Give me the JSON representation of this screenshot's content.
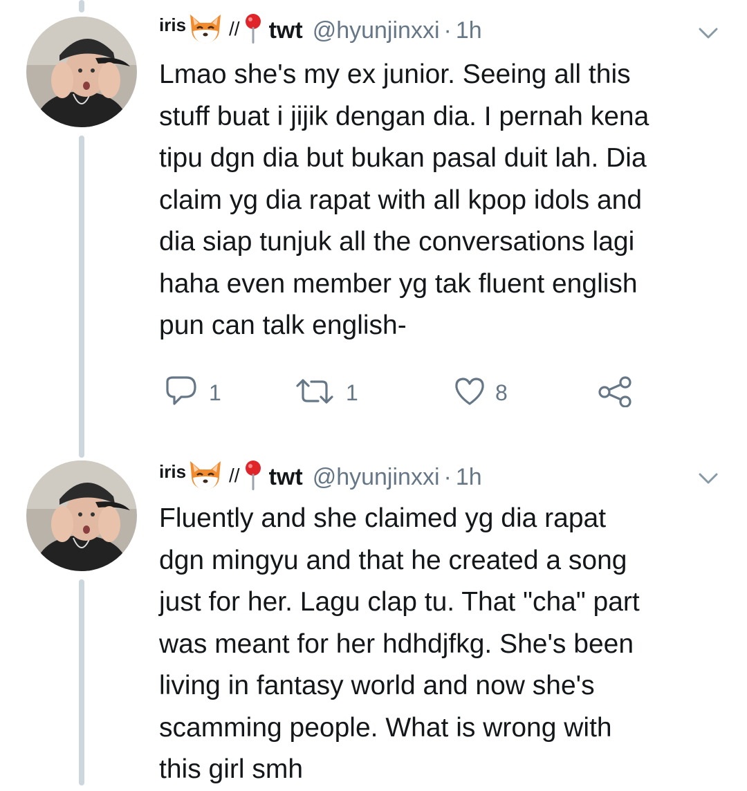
{
  "tweets": [
    {
      "user": {
        "name": "iris",
        "separator": "//",
        "location_name": "twt",
        "handle": "@hyunjinxxi",
        "dot": "·",
        "time": "1h"
      },
      "text": "Lmao she's my ex junior. Seeing all this\nstuff buat i jijik dengan dia. I pernah kena\ntipu dgn dia but bukan pasal duit lah. Dia\nclaim yg dia rapat with all kpop idols and\ndia siap tunjuk all the conversations lagi\nhaha even member yg tak fluent english\npun can talk english-",
      "actions": {
        "replies": "1",
        "retweets": "1",
        "likes": "8"
      },
      "icons": [
        "fox-emoji",
        "pin-emoji",
        "chevron-down-icon",
        "reply-icon",
        "retweet-icon",
        "heart-icon",
        "share-icon"
      ]
    },
    {
      "user": {
        "name": "iris",
        "separator": "//",
        "location_name": "twt",
        "handle": "@hyunjinxxi",
        "dot": "·",
        "time": "1h"
      },
      "text": "Fluently and she claimed yg dia rapat\ndgn mingyu and that he created a song\njust for her. Lagu clap tu. That \"cha\" part\nwas meant for her hdhdjfkg. She's been\nliving in fantasy world and now she's\nscamming people. What is wrong with\nthis girl smh",
      "icons": [
        "fox-emoji",
        "pin-emoji",
        "chevron-down-icon"
      ]
    }
  ],
  "colors": {
    "text": "#14171a",
    "secondary": "#657786",
    "thread_line": "#ccd6dd"
  }
}
